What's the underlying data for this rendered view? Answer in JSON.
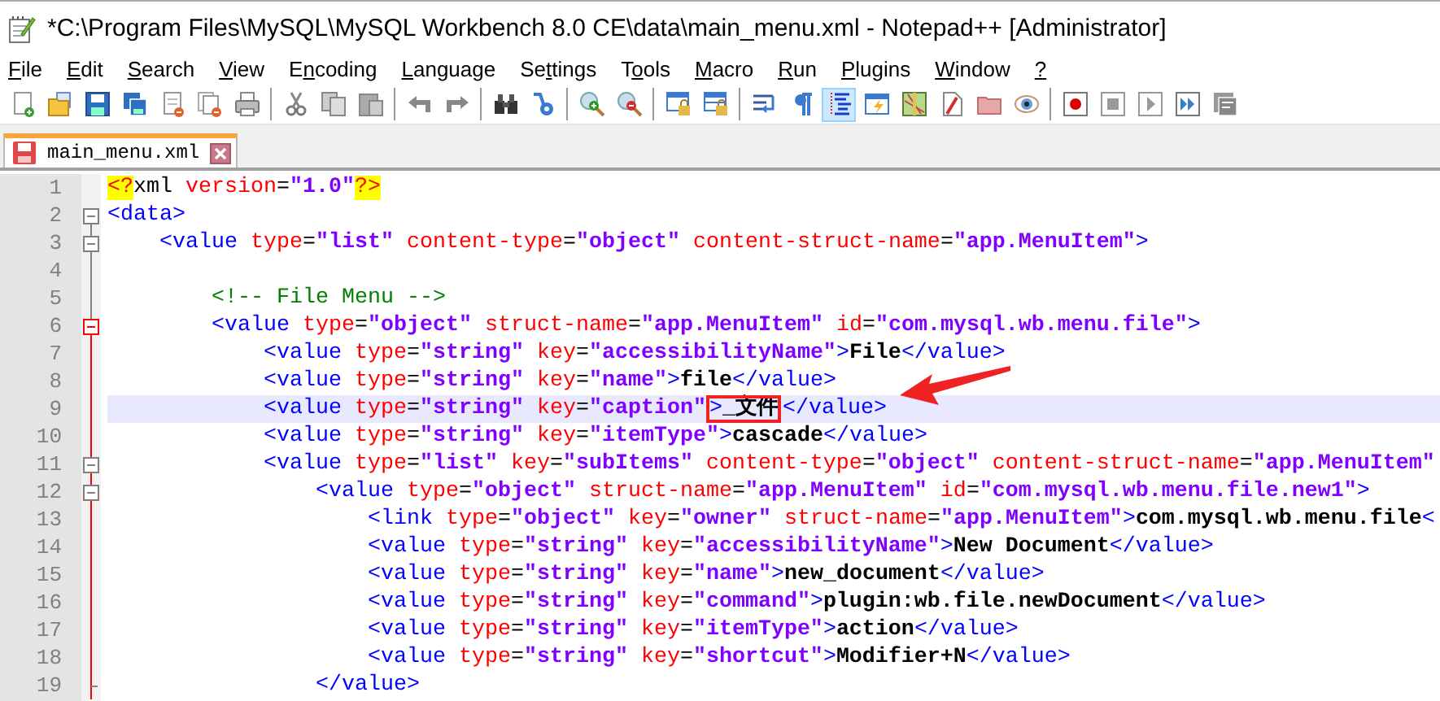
{
  "window": {
    "title": "*C:\\Program Files\\MySQL\\MySQL Workbench 8.0 CE\\data\\main_menu.xml - Notepad++ [Administrator]"
  },
  "menu": [
    {
      "underlined": "F",
      "rest": "ile"
    },
    {
      "underlined": "E",
      "rest": "dit"
    },
    {
      "underlined": "S",
      "rest": "earch"
    },
    {
      "underlined": "V",
      "rest": "iew"
    },
    {
      "lead": "E",
      "underlined": "n",
      "rest": "coding"
    },
    {
      "underlined": "L",
      "rest": "anguage"
    },
    {
      "lead": "Se",
      "underlined": "t",
      "rest": "tings"
    },
    {
      "lead": "T",
      "underlined": "o",
      "rest": "ols"
    },
    {
      "underlined": "M",
      "rest": "acro"
    },
    {
      "underlined": "R",
      "rest": "un"
    },
    {
      "underlined": "P",
      "rest": "lugins"
    },
    {
      "underlined": "W",
      "rest": "indow"
    },
    {
      "underlined": "?"
    }
  ],
  "toolbar": [
    {
      "pressed": false
    },
    {
      "pressed": false
    },
    {
      "pressed": false
    },
    {
      "pressed": false
    },
    {
      "pressed": false
    },
    {
      "pressed": false
    },
    {
      "pressed": false
    },
    {
      "pressed": false
    },
    {
      "pressed": false
    },
    {
      "pressed": false
    },
    {
      "pressed": false
    },
    {
      "pressed": false
    },
    {
      "pressed": false
    },
    {
      "pressed": false
    },
    {
      "pressed": false
    },
    {
      "pressed": false
    },
    {
      "pressed": false
    },
    {
      "pressed": false
    },
    {
      "pressed": false
    },
    {
      "pressed": false
    },
    {
      "pressed": true
    },
    {
      "pressed": false
    },
    {
      "pressed": false
    },
    {
      "pressed": false
    },
    {
      "pressed": false
    },
    {
      "pressed": false
    },
    {
      "pressed": false
    },
    {
      "pressed": false
    },
    {
      "pressed": false
    },
    {
      "pressed": false
    },
    {
      "pressed": false
    }
  ],
  "tabs": [
    {
      "label": "main_menu.xml",
      "selected": true,
      "modified": true
    }
  ],
  "editor": {
    "lines": [
      {
        "number": "1",
        "current": false,
        "kind": "plain",
        "tokens": [
          {
            "kind": "pi",
            "text": "<?"
          },
          {
            "kind": "plain",
            "text": "xml"
          },
          {
            "kind": "attr",
            "text": " version"
          },
          {
            "kind": "op",
            "text": "="
          },
          {
            "kind": "str",
            "text": "\"1.0\""
          },
          {
            "kind": "pi",
            "text": "?>"
          }
        ]
      },
      {
        "number": "2",
        "current": false,
        "kind": "start",
        "highlighted_fold": false,
        "tokens": [
          {
            "kind": "tag",
            "text": "<data>"
          }
        ]
      },
      {
        "number": "3",
        "current": false,
        "kind": "start",
        "highlighted_fold": false,
        "tokens": [
          {
            "kind": "tag",
            "text": "    <value"
          },
          {
            "kind": "attr",
            "text": " type"
          },
          {
            "kind": "op",
            "text": "="
          },
          {
            "kind": "str",
            "text": "\"list\""
          },
          {
            "kind": "attr",
            "text": " content-type"
          },
          {
            "kind": "op",
            "text": "="
          },
          {
            "kind": "str",
            "text": "\"object\""
          },
          {
            "kind": "attr",
            "text": " content-struct-name"
          },
          {
            "kind": "op",
            "text": "="
          },
          {
            "kind": "str",
            "text": "\"app.MenuItem\""
          },
          {
            "kind": "tag",
            "text": ">"
          }
        ]
      },
      {
        "number": "4",
        "current": false,
        "kind": "body",
        "highlighted_fold": false
      },
      {
        "number": "5",
        "current": false,
        "kind": "body",
        "highlighted_fold": false,
        "tokens": [
          {
            "kind": "comment",
            "text": "        <!-- File Menu -->"
          }
        ]
      },
      {
        "number": "6",
        "current": false,
        "kind": "start",
        "highlighted_fold": true,
        "tokens": [
          {
            "kind": "tag",
            "text": "        <value"
          },
          {
            "kind": "attr",
            "text": " type"
          },
          {
            "kind": "op",
            "text": "="
          },
          {
            "kind": "str",
            "text": "\"object\""
          },
          {
            "kind": "attr",
            "text": " struct-name"
          },
          {
            "kind": "op",
            "text": "="
          },
          {
            "kind": "str",
            "text": "\"app.MenuItem\""
          },
          {
            "kind": "attr",
            "text": " id"
          },
          {
            "kind": "op",
            "text": "="
          },
          {
            "kind": "str",
            "text": "\"com.mysql.wb.menu.file\""
          },
          {
            "kind": "tag",
            "text": ">"
          }
        ]
      },
      {
        "number": "7",
        "current": false,
        "kind": "body",
        "highlighted_fold": true,
        "tokens": [
          {
            "kind": "tag",
            "text": "            <value"
          },
          {
            "kind": "attr",
            "text": " type"
          },
          {
            "kind": "op",
            "text": "="
          },
          {
            "kind": "str",
            "text": "\"string\""
          },
          {
            "kind": "attr",
            "text": " key"
          },
          {
            "kind": "op",
            "text": "="
          },
          {
            "kind": "str",
            "text": "\"accessibilityName\""
          },
          {
            "kind": "tag",
            "text": ">"
          },
          {
            "kind": "text",
            "text": "File"
          },
          {
            "kind": "tag",
            "text": "</value>"
          }
        ]
      },
      {
        "number": "8",
        "current": false,
        "kind": "body",
        "highlighted_fold": true,
        "tokens": [
          {
            "kind": "tag",
            "text": "            <value"
          },
          {
            "kind": "attr",
            "text": " type"
          },
          {
            "kind": "op",
            "text": "="
          },
          {
            "kind": "str",
            "text": "\"string\""
          },
          {
            "kind": "attr",
            "text": " key"
          },
          {
            "kind": "op",
            "text": "="
          },
          {
            "kind": "str",
            "text": "\"name\""
          },
          {
            "kind": "tag",
            "text": ">"
          },
          {
            "kind": "text",
            "text": "file"
          },
          {
            "kind": "tag",
            "text": "</value>"
          }
        ]
      },
      {
        "number": "9",
        "current": true,
        "kind": "body",
        "highlighted_fold": true,
        "tokens": [
          {
            "kind": "tag",
            "text": "            <value",
            "circled": false
          },
          {
            "kind": "attr",
            "text": " type",
            "circled": false
          },
          {
            "kind": "op",
            "text": "=",
            "circled": false
          },
          {
            "kind": "str",
            "text": "\"string\"",
            "circled": false
          },
          {
            "kind": "attr",
            "text": " key",
            "circled": false
          },
          {
            "kind": "op",
            "text": "=",
            "circled": false
          },
          {
            "kind": "str",
            "text": "\"caption\"",
            "circled": false
          },
          {
            "kind": "tag",
            "text": ">",
            "circled": true
          },
          {
            "kind": "text",
            "text": "_文件",
            "circled": true
          },
          {
            "kind": "tag",
            "text": "</value>",
            "circled": false
          }
        ]
      },
      {
        "number": "10",
        "current": false,
        "kind": "body",
        "highlighted_fold": true,
        "tokens": [
          {
            "kind": "tag",
            "text": "            <value"
          },
          {
            "kind": "attr",
            "text": " type"
          },
          {
            "kind": "op",
            "text": "="
          },
          {
            "kind": "str",
            "text": "\"string\""
          },
          {
            "kind": "attr",
            "text": " key"
          },
          {
            "kind": "op",
            "text": "="
          },
          {
            "kind": "str",
            "text": "\"itemType\""
          },
          {
            "kind": "tag",
            "text": ">"
          },
          {
            "kind": "text",
            "text": "cascade"
          },
          {
            "kind": "tag",
            "text": "</value>"
          }
        ]
      },
      {
        "number": "11",
        "current": false,
        "kind": "start",
        "highlighted_fold": true,
        "tokens": [
          {
            "kind": "tag",
            "text": "            <value"
          },
          {
            "kind": "attr",
            "text": " type"
          },
          {
            "kind": "op",
            "text": "="
          },
          {
            "kind": "str",
            "text": "\"list\""
          },
          {
            "kind": "attr",
            "text": " key"
          },
          {
            "kind": "op",
            "text": "="
          },
          {
            "kind": "str",
            "text": "\"subItems\""
          },
          {
            "kind": "attr",
            "text": " content-type"
          },
          {
            "kind": "op",
            "text": "="
          },
          {
            "kind": "str",
            "text": "\"object\""
          },
          {
            "kind": "attr",
            "text": " content-struct-name"
          },
          {
            "kind": "op",
            "text": "="
          },
          {
            "kind": "str",
            "text": "\"app.MenuItem\""
          }
        ]
      },
      {
        "number": "12",
        "current": false,
        "kind": "start",
        "highlighted_fold": true,
        "tokens": [
          {
            "kind": "tag",
            "text": "                <value"
          },
          {
            "kind": "attr",
            "text": " type"
          },
          {
            "kind": "op",
            "text": "="
          },
          {
            "kind": "str",
            "text": "\"object\""
          },
          {
            "kind": "attr",
            "text": " struct-name"
          },
          {
            "kind": "op",
            "text": "="
          },
          {
            "kind": "str",
            "text": "\"app.MenuItem\""
          },
          {
            "kind": "attr",
            "text": " id"
          },
          {
            "kind": "op",
            "text": "="
          },
          {
            "kind": "str",
            "text": "\"com.mysql.wb.menu.file.new1\""
          },
          {
            "kind": "tag",
            "text": ">"
          }
        ]
      },
      {
        "number": "13",
        "current": false,
        "kind": "body",
        "highlighted_fold": true,
        "tokens": [
          {
            "kind": "tag",
            "text": "                    <link"
          },
          {
            "kind": "attr",
            "text": " type"
          },
          {
            "kind": "op",
            "text": "="
          },
          {
            "kind": "str",
            "text": "\"object\""
          },
          {
            "kind": "attr",
            "text": " key"
          },
          {
            "kind": "op",
            "text": "="
          },
          {
            "kind": "str",
            "text": "\"owner\""
          },
          {
            "kind": "attr",
            "text": " struct-name"
          },
          {
            "kind": "op",
            "text": "="
          },
          {
            "kind": "str",
            "text": "\"app.MenuItem\""
          },
          {
            "kind": "tag",
            "text": ">"
          },
          {
            "kind": "text",
            "text": "com.mysql.wb.menu.file"
          },
          {
            "kind": "tag",
            "text": "<"
          }
        ]
      },
      {
        "number": "14",
        "current": false,
        "kind": "body",
        "highlighted_fold": true,
        "tokens": [
          {
            "kind": "tag",
            "text": "                    <value"
          },
          {
            "kind": "attr",
            "text": " type"
          },
          {
            "kind": "op",
            "text": "="
          },
          {
            "kind": "str",
            "text": "\"string\""
          },
          {
            "kind": "attr",
            "text": " key"
          },
          {
            "kind": "op",
            "text": "="
          },
          {
            "kind": "str",
            "text": "\"accessibilityName\""
          },
          {
            "kind": "tag",
            "text": ">"
          },
          {
            "kind": "text",
            "text": "New Document"
          },
          {
            "kind": "tag",
            "text": "</value>"
          }
        ]
      },
      {
        "number": "15",
        "current": false,
        "kind": "body",
        "highlighted_fold": true,
        "tokens": [
          {
            "kind": "tag",
            "text": "                    <value"
          },
          {
            "kind": "attr",
            "text": " type"
          },
          {
            "kind": "op",
            "text": "="
          },
          {
            "kind": "str",
            "text": "\"string\""
          },
          {
            "kind": "attr",
            "text": " key"
          },
          {
            "kind": "op",
            "text": "="
          },
          {
            "kind": "str",
            "text": "\"name\""
          },
          {
            "kind": "tag",
            "text": ">"
          },
          {
            "kind": "text",
            "text": "new_document"
          },
          {
            "kind": "tag",
            "text": "</value>"
          }
        ]
      },
      {
        "number": "16",
        "current": false,
        "kind": "body",
        "highlighted_fold": true,
        "tokens": [
          {
            "kind": "tag",
            "text": "                    <value"
          },
          {
            "kind": "attr",
            "text": " type"
          },
          {
            "kind": "op",
            "text": "="
          },
          {
            "kind": "str",
            "text": "\"string\""
          },
          {
            "kind": "attr",
            "text": " key"
          },
          {
            "kind": "op",
            "text": "="
          },
          {
            "kind": "str",
            "text": "\"command\""
          },
          {
            "kind": "tag",
            "text": ">"
          },
          {
            "kind": "text",
            "text": "plugin:wb.file.newDocument"
          },
          {
            "kind": "tag",
            "text": "</value>"
          }
        ]
      },
      {
        "number": "17",
        "current": false,
        "kind": "body",
        "highlighted_fold": true,
        "tokens": [
          {
            "kind": "tag",
            "text": "                    <value"
          },
          {
            "kind": "attr",
            "text": " type"
          },
          {
            "kind": "op",
            "text": "="
          },
          {
            "kind": "str",
            "text": "\"string\""
          },
          {
            "kind": "attr",
            "text": " key"
          },
          {
            "kind": "op",
            "text": "="
          },
          {
            "kind": "str",
            "text": "\"itemType\""
          },
          {
            "kind": "tag",
            "text": ">"
          },
          {
            "kind": "text",
            "text": "action"
          },
          {
            "kind": "tag",
            "text": "</value>"
          }
        ]
      },
      {
        "number": "18",
        "current": false,
        "kind": "body",
        "highlighted_fold": true,
        "tokens": [
          {
            "kind": "tag",
            "text": "                    <value"
          },
          {
            "kind": "attr",
            "text": " type"
          },
          {
            "kind": "op",
            "text": "="
          },
          {
            "kind": "str",
            "text": "\"string\""
          },
          {
            "kind": "attr",
            "text": " key"
          },
          {
            "kind": "op",
            "text": "="
          },
          {
            "kind": "str",
            "text": "\"shortcut\""
          },
          {
            "kind": "tag",
            "text": ">"
          },
          {
            "kind": "text",
            "text": "Modifier+N"
          },
          {
            "kind": "tag",
            "text": "</value>"
          }
        ]
      },
      {
        "number": "19",
        "current": false,
        "kind": "end",
        "highlighted_fold": true,
        "tokens": [
          {
            "kind": "tag",
            "text": "                </value>"
          }
        ]
      }
    ]
  }
}
